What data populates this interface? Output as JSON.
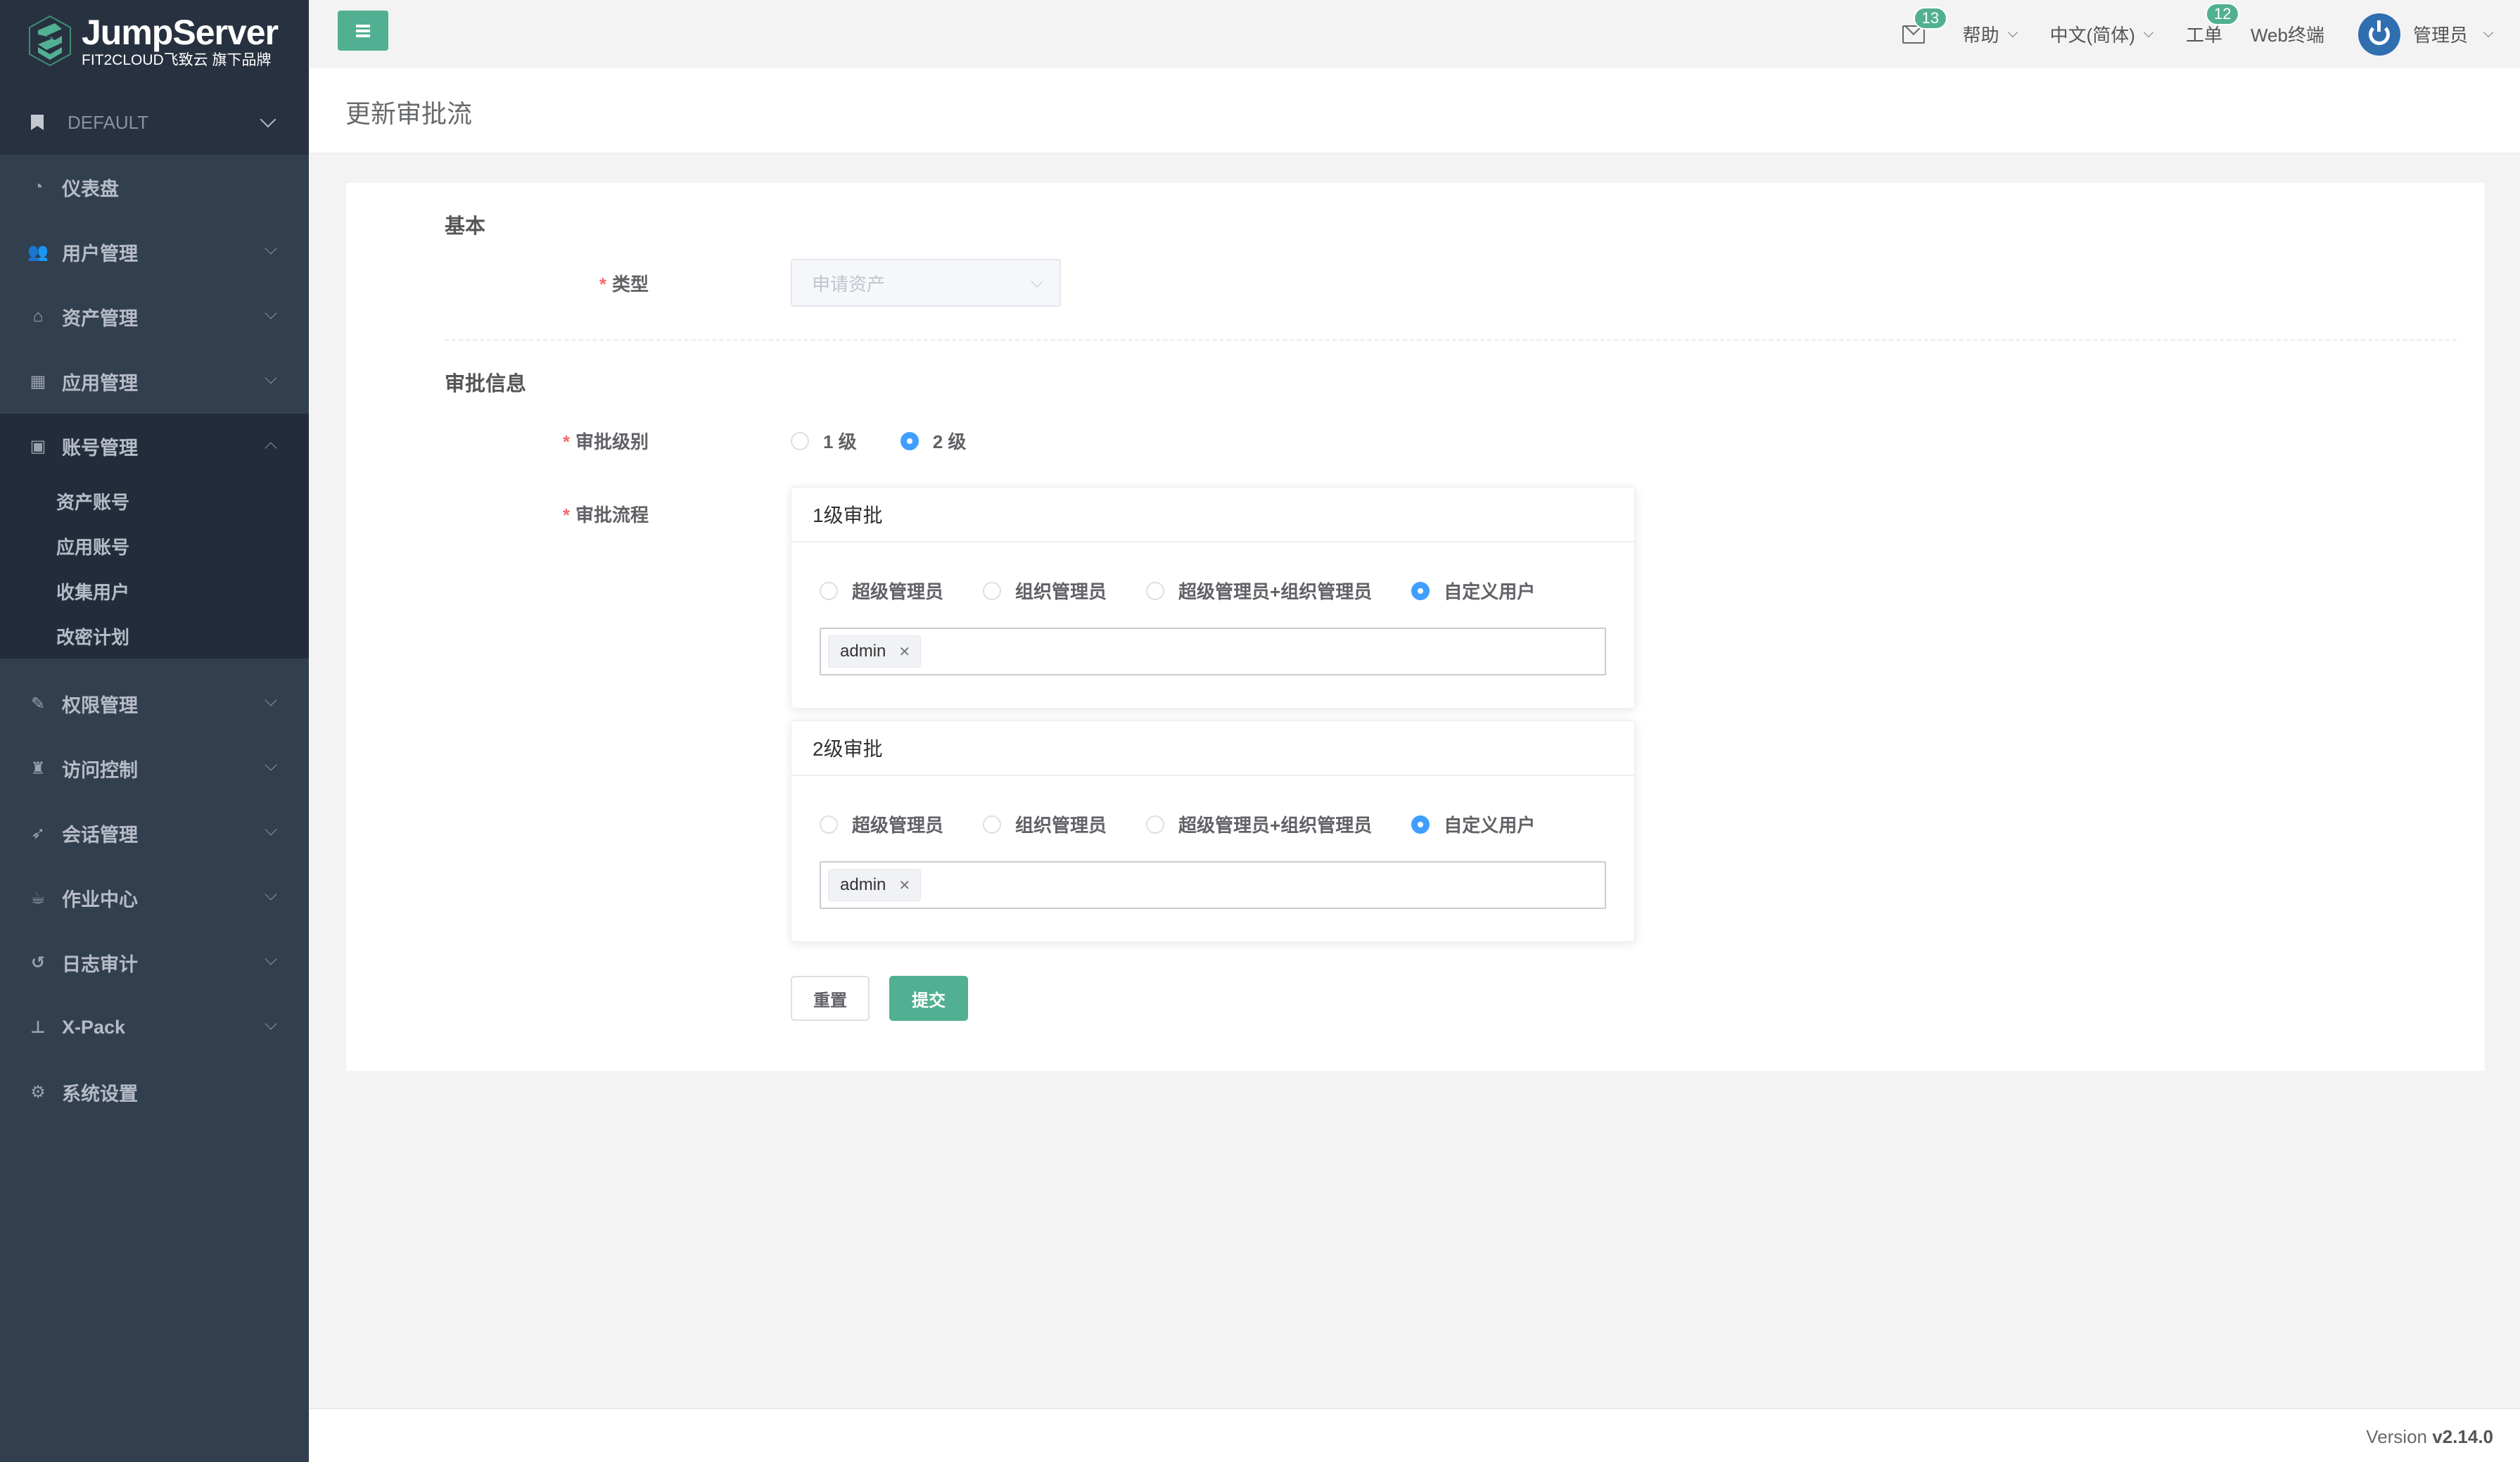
{
  "brand": {
    "title": "JumpServer",
    "subtitle": "FIT2CLOUD飞致云 旗下品牌",
    "accent_color": "#52b092"
  },
  "org_selector": {
    "icon": "bookmark-icon",
    "value": "DEFAULT"
  },
  "sidebar": {
    "items": [
      {
        "label": "仪表盘",
        "icon": "dashboard-icon",
        "expandable": false
      },
      {
        "label": "用户管理",
        "icon": "users-icon",
        "expandable": true
      },
      {
        "label": "资产管理",
        "icon": "inbox-icon",
        "expandable": true
      },
      {
        "label": "应用管理",
        "icon": "grid-icon",
        "expandable": true
      },
      {
        "label": "账号管理",
        "icon": "address-card-icon",
        "expandable": true,
        "expanded": true,
        "children": [
          "资产账号",
          "应用账号",
          "收集用户",
          "改密计划"
        ]
      },
      {
        "label": "权限管理",
        "icon": "edit-icon",
        "expandable": true
      },
      {
        "label": "访问控制",
        "icon": "castle-icon",
        "expandable": true
      },
      {
        "label": "会话管理",
        "icon": "rocket-icon",
        "expandable": true
      },
      {
        "label": "作业中心",
        "icon": "coffee-icon",
        "expandable": true
      },
      {
        "label": "日志审计",
        "icon": "history-icon",
        "expandable": true
      },
      {
        "label": "X-Pack",
        "icon": "sitemap-icon",
        "expandable": true
      },
      {
        "label": "系统设置",
        "icon": "cogs-icon",
        "expandable": false
      }
    ]
  },
  "header": {
    "mail_badge": "13",
    "help": "帮助",
    "language": "中文(简体)",
    "tickets": "工单",
    "tickets_badge": "12",
    "web_terminal": "Web终端",
    "user": "管理员"
  },
  "page": {
    "title": "更新审批流"
  },
  "form": {
    "basic_section": "基本",
    "type_label": "类型",
    "type_value": "申请资产",
    "approval_section": "审批信息",
    "level_label": "审批级别",
    "level_options": [
      "1 级",
      "2 级"
    ],
    "level_selected": "2 级",
    "flow_label": "审批流程",
    "approvals": [
      {
        "title": "1级审批",
        "options": [
          "超级管理员",
          "组织管理员",
          "超级管理员+组织管理员",
          "自定义用户"
        ],
        "selected": "自定义用户",
        "users": [
          "admin"
        ]
      },
      {
        "title": "2级审批",
        "options": [
          "超级管理员",
          "组织管理员",
          "超级管理员+组织管理员",
          "自定义用户"
        ],
        "selected": "自定义用户",
        "users": [
          "admin"
        ]
      }
    ],
    "reset_label": "重置",
    "submit_label": "提交"
  },
  "footer": {
    "version_prefix": "Version",
    "version": "v2.14.0"
  }
}
